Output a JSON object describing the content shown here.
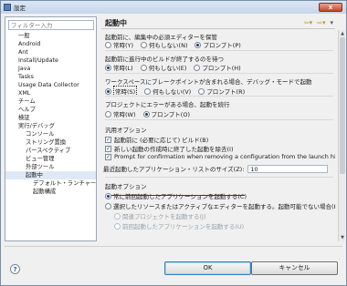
{
  "window": {
    "title": "設定",
    "close_label": "x"
  },
  "filter": {
    "placeholder": "フィルター入力"
  },
  "tree": [
    {
      "label": "一般",
      "level": 0
    },
    {
      "label": "Android",
      "level": 0
    },
    {
      "label": "Ant",
      "level": 0
    },
    {
      "label": "Install/Update",
      "level": 0
    },
    {
      "label": "Java",
      "level": 0
    },
    {
      "label": "Tasks",
      "level": 0
    },
    {
      "label": "Usage Data Collector",
      "level": 0
    },
    {
      "label": "XML",
      "level": 0
    },
    {
      "label": "チーム",
      "level": 0
    },
    {
      "label": "ヘルプ",
      "level": 0
    },
    {
      "label": "検証",
      "level": 0
    },
    {
      "label": "実行/デバッグ",
      "level": 0
    },
    {
      "label": "コンソール",
      "level": 1
    },
    {
      "label": "ストリング置換",
      "level": 1
    },
    {
      "label": "パースペクティブ",
      "level": 1
    },
    {
      "label": "ビュー管理",
      "level": 1
    },
    {
      "label": "外部ツール",
      "level": 1
    },
    {
      "label": "起動中",
      "level": 1
    },
    {
      "label": "デフォルト・ランチャー",
      "level": 2
    },
    {
      "label": "起動構成",
      "level": 2
    }
  ],
  "page": {
    "title": "起動中"
  },
  "groups": {
    "g1": {
      "label": "起動前に、編集中の必須エディターを保管",
      "opts": [
        "常時(Y)",
        "何もしない(N)",
        "プロンプト(P)"
      ],
      "selected": 2
    },
    "g2": {
      "label": "起動前に進行中のビルドが終了するのを待つ",
      "opts": [
        "常時(L)",
        "何もしない(E)",
        "プロンプト(H)"
      ],
      "selected": 0
    },
    "g3": {
      "label": "ワークスペースにブレークポイントが含まれる場合、デバッグ・モードで起動",
      "opts": [
        "常時(S)",
        "何もしない(V)",
        "プロンプト(R)"
      ],
      "selected": 0
    },
    "g4": {
      "label": "プロジェクトにエラーがある場合、起動を続行",
      "opts": [
        "常時(W)",
        "プロンプト(O)"
      ],
      "selected": 1
    }
  },
  "general": {
    "label": "汎用オプション",
    "checks": [
      {
        "label": "起動前に (必要に応じて) ビルド(B)",
        "checked": true
      },
      {
        "label": "新しい起動の作成時に終了した起動を除去(I)",
        "checked": true
      },
      {
        "label": "Prompt for confirmation when removing a configuration from the launch history",
        "checked": true
      }
    ],
    "history_label": "最近起動したアプリケーション・リストのサイズ(Z):",
    "history_value": "10"
  },
  "launch": {
    "label": "起動オプション",
    "opt1": "常に前回起動したアプリケーションを起動する(C)",
    "opt2": "選択したリソースまたはアクティブなエディターを起動する。起動可能でない場合(H):",
    "sub1": "関連プロジェクトを起動する(J)",
    "sub2": "前回起動したアプリケーションを起動する(U)"
  },
  "buttons": {
    "help": "?",
    "ok": "OK",
    "cancel": "キャンセル"
  },
  "colors": {
    "accent": "#c00000",
    "selection": "#dfe9f6"
  },
  "icons": {
    "nav_back": "back-arrow-icon",
    "nav_forward": "forward-arrow-icon",
    "menu": "menu-icon"
  }
}
